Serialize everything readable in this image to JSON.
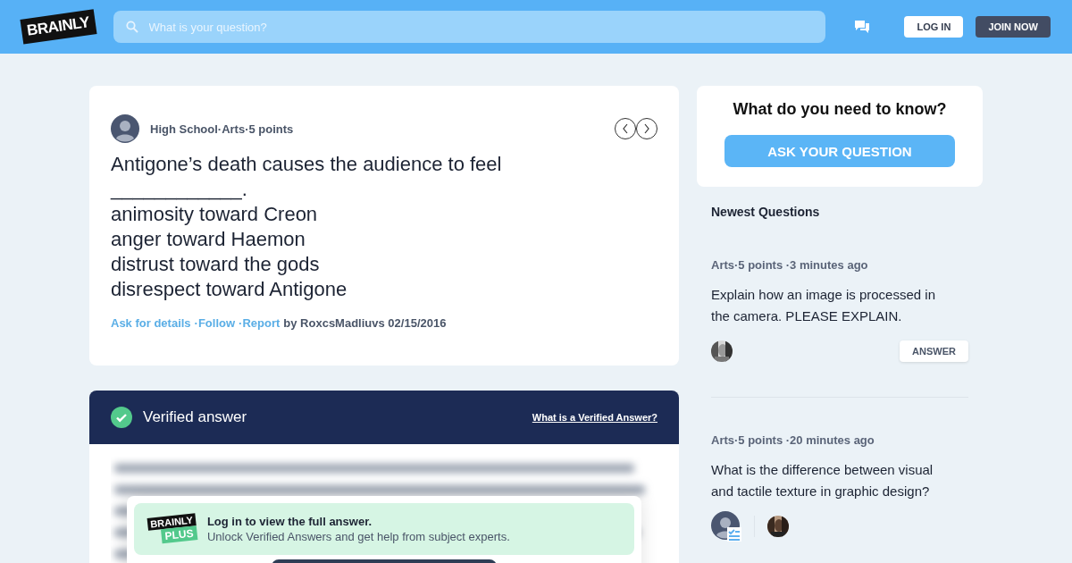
{
  "header": {
    "logo": "BRAINLY",
    "search": {
      "placeholder": "What is your question?"
    },
    "buttons": [
      {
        "label": "LOG IN",
        "kind": "light"
      },
      {
        "label": "JOIN NOW",
        "kind": "dark"
      }
    ]
  },
  "question": {
    "meta": "High School·Arts·5 points",
    "title": "Antigone’s death causes the audience to feel ____________.",
    "options": [
      "animosity toward Creon",
      "anger toward Haemon",
      "distrust toward the gods",
      "disrespect toward Antigone"
    ],
    "links": [
      "Ask for details",
      "·Follow",
      "·Report"
    ],
    "byline": "by RoxcsMadliuvs 02/15/2016"
  },
  "answer": {
    "title": "Verified answer",
    "help_link": "What is a Verified Answer?",
    "promo": {
      "logo_top": "BRAINLY",
      "logo_bottom": "PLUS",
      "heading": "Log in to view the full answer.",
      "text": "Unlock Verified Answers and get help from subject experts."
    }
  },
  "ask": {
    "heading": "What do you need to know?",
    "button": "ASK YOUR QUESTION"
  },
  "newest": {
    "heading": "Newest Questions",
    "items": [
      {
        "meta": "Arts·5 points ·3 minutes ago",
        "text": "Explain how an image is processed in the camera. PLEASE EXPLAIN.",
        "avatars": [
          {
            "kind": "picture"
          }
        ],
        "answer_button": "ANSWER"
      },
      {
        "meta": "Arts·5 points ·20 minutes ago",
        "text": "What is the difference between visual and tactile texture in graphic design?",
        "avatars": [
          {
            "kind": "default"
          },
          {
            "kind": "picture"
          }
        ]
      }
    ]
  }
}
